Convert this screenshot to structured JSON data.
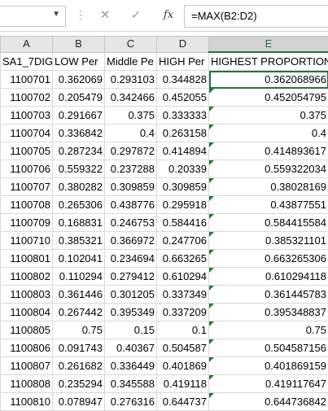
{
  "formula_bar": {
    "name_box": "",
    "cancel_icon": "✕",
    "enter_icon": "✓",
    "fx_label": "fx",
    "formula": "=MAX(B2:D2)"
  },
  "columns": [
    "A",
    "B",
    "C",
    "D",
    "E"
  ],
  "selected_column": "E",
  "headers": [
    "SA1_7DIG",
    "LOW Per",
    "Middle Pe",
    "HIGH Per",
    "HIGHEST PROPORTION"
  ],
  "rows": [
    [
      "1100701",
      "0.362069",
      "0.293103",
      "0.344828",
      "0.362068966"
    ],
    [
      "1100702",
      "0.205479",
      "0.342466",
      "0.452055",
      "0.452054795"
    ],
    [
      "1100703",
      "0.291667",
      "0.375",
      "0.333333",
      "0.375"
    ],
    [
      "1100704",
      "0.336842",
      "0.4",
      "0.263158",
      "0.4"
    ],
    [
      "1100705",
      "0.287234",
      "0.297872",
      "0.414894",
      "0.414893617"
    ],
    [
      "1100706",
      "0.559322",
      "0.237288",
      "0.20339",
      "0.559322034"
    ],
    [
      "1100707",
      "0.380282",
      "0.309859",
      "0.309859",
      "0.38028169"
    ],
    [
      "1100708",
      "0.265306",
      "0.438776",
      "0.295918",
      "0.43877551"
    ],
    [
      "1100709",
      "0.168831",
      "0.246753",
      "0.584416",
      "0.584415584"
    ],
    [
      "1100710",
      "0.385321",
      "0.366972",
      "0.247706",
      "0.385321101"
    ],
    [
      "1100801",
      "0.102041",
      "0.234694",
      "0.663265",
      "0.663265306"
    ],
    [
      "1100802",
      "0.110294",
      "0.279412",
      "0.610294",
      "0.610294118"
    ],
    [
      "1100803",
      "0.361446",
      "0.301205",
      "0.337349",
      "0.361445783"
    ],
    [
      "1100804",
      "0.267442",
      "0.395349",
      "0.337209",
      "0.395348837"
    ],
    [
      "1100805",
      "0.75",
      "0.15",
      "0.1",
      "0.75"
    ],
    [
      "1100806",
      "0.091743",
      "0.40367",
      "0.504587",
      "0.504587156"
    ],
    [
      "1100807",
      "0.261682",
      "0.336449",
      "0.401869",
      "0.401869159"
    ],
    [
      "1100808",
      "0.235294",
      "0.345588",
      "0.419118",
      "0.419117647"
    ],
    [
      "1100810",
      "0.078947",
      "0.276316",
      "0.644737",
      "0.644736842"
    ]
  ],
  "colors": {
    "accent": "#217346",
    "error_triangle": "#1e7b34",
    "gridline": "#d9d9d9"
  }
}
